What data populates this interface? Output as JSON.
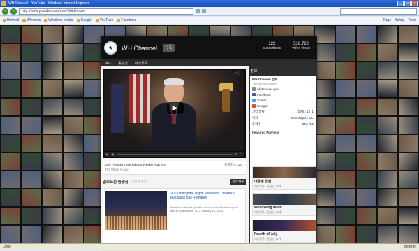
{
  "browser": {
    "title": "WH Channel - YouTube - Windows Internet Explorer",
    "address": "http://www.youtube.com/user/whitehouse",
    "search_placeholder": "",
    "links": [
      "Hotmail",
      "Windows",
      "Windows Media",
      "Google",
      "YouTube",
      "Facebook"
    ],
    "menus": [
      "Page",
      "Safety",
      "Tools"
    ],
    "status": "Done",
    "zone": "Internet"
  },
  "channel": {
    "name": "WH Channel",
    "subscribe": "구독",
    "stats": [
      {
        "n": "122",
        "label": "subscribers"
      },
      {
        "n": "518,722",
        "label": "video views"
      }
    ],
    "tabs": [
      "피드",
      "동영상",
      "재생목록"
    ]
  },
  "video": {
    "title": "Vice President Joe Biden's Weekly Address",
    "views": "조회수 9,124",
    "desc": "The White House"
  },
  "section": {
    "title": "업로드한 동영상",
    "sub": "공개 동영상",
    "btn": "전체 재생"
  },
  "featured_video": {
    "title": "2013 Inaugural Night: President Obama's Inaugural Ball Remarks",
    "desc": "President Obama speaks to the crowd at the Inaugural Ball in Washington, D.C. January 21, 2013"
  },
  "about": {
    "panel_title": "정보",
    "name": "WH Channel 정보",
    "subtitle": "The White House",
    "links": [
      {
        "icon": "globe-icon",
        "text": "whitehouse.gov"
      },
      {
        "icon": "facebook-icon",
        "text": "Facebook"
      },
      {
        "icon": "twitter-icon",
        "text": "Twitter"
      },
      {
        "icon": "googleplus-icon",
        "text": "Google+"
      }
    ],
    "kv": [
      {
        "k": "가입 날짜",
        "v": "2008. 12. 1"
      },
      {
        "k": "위치",
        "v": "Washington, DC"
      },
      {
        "k": "조회수",
        "v": "518,722"
      }
    ],
    "featured_title": "Featured Playlists",
    "playlists": [
      {
        "name": "대통령 연설",
        "count": "재생목록 · 동영상 35개"
      },
      {
        "name": "West Wing Week",
        "count": "재생목록 · 동영상 48개"
      },
      {
        "name": "Fourth of July",
        "count": "재생목록 · 동영상 12개"
      }
    ]
  }
}
